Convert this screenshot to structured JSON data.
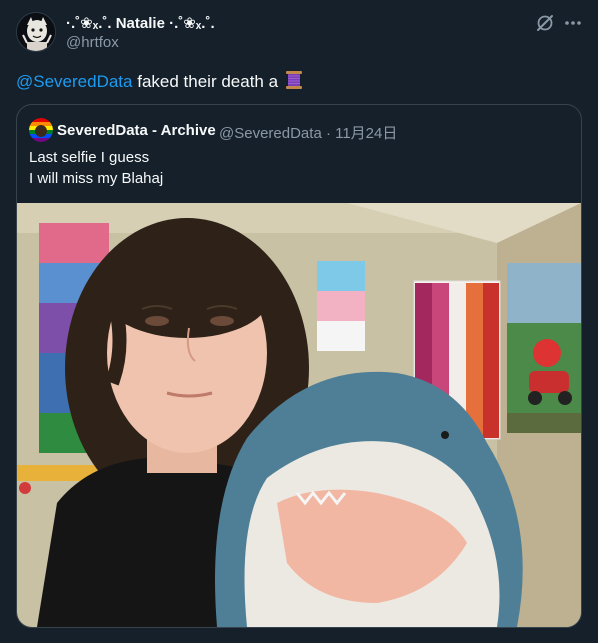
{
  "tweet": {
    "author_name": "·.˚❀ₓ.˚. Natalie ·.˚❀ₓ.˚.",
    "author_handle": "@hrtfox",
    "mention": "@SeveredData",
    "text_after_mention": " faked their death a",
    "emoji": "spool-of-thread-icon"
  },
  "quote": {
    "author_name": "SeveredData - Archive",
    "meta": "@SeveredData · 11月24日",
    "line1": "Last selfie I guess",
    "line2": "I will miss my Blahaj"
  },
  "colors": {
    "background": "#15202b",
    "accent": "#1d9bf0",
    "secondary_text": "#8b98a5",
    "border": "#38444d"
  }
}
